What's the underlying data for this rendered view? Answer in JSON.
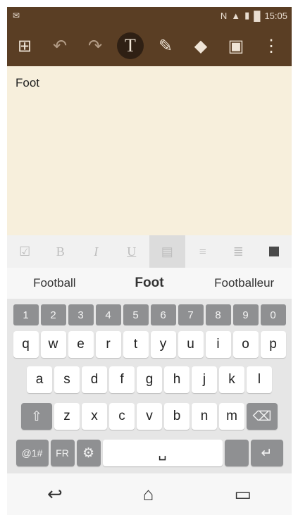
{
  "status": {
    "time": "15:05"
  },
  "toolbar": {
    "items": [
      {
        "name": "grid-icon",
        "glyph": "⊞"
      },
      {
        "name": "undo-icon",
        "glyph": "↶"
      },
      {
        "name": "redo-icon",
        "glyph": "↷"
      },
      {
        "name": "text-tool-icon",
        "glyph": "T"
      },
      {
        "name": "pen-icon",
        "glyph": "✎"
      },
      {
        "name": "eraser-icon",
        "glyph": "⌫"
      },
      {
        "name": "save-icon",
        "glyph": "💾"
      },
      {
        "name": "more-icon",
        "glyph": "⋮"
      }
    ]
  },
  "note": {
    "text": "Foot"
  },
  "format": {
    "items": [
      "☑",
      "B",
      "I",
      "U",
      "▤",
      "≡",
      "≣",
      "■"
    ]
  },
  "suggestions": {
    "left": "Football",
    "center": "Foot",
    "right": "Footballeur"
  },
  "keyboard": {
    "numbers": [
      "1",
      "2",
      "3",
      "4",
      "5",
      "6",
      "7",
      "8",
      "9",
      "0"
    ],
    "row1": [
      "q",
      "w",
      "e",
      "r",
      "t",
      "y",
      "u",
      "i",
      "o",
      "p"
    ],
    "row2": [
      "a",
      "s",
      "d",
      "f",
      "g",
      "h",
      "j",
      "k",
      "l"
    ],
    "row3": [
      "z",
      "x",
      "c",
      "v",
      "b",
      "n",
      "m"
    ],
    "shift": "⇧",
    "backspace": "⌫",
    "sym": "@1#",
    "lang": "FR",
    "settings": "⚙",
    "space": "␣",
    "enter": "↵"
  },
  "nav": {
    "back": "↩",
    "home": "⌂",
    "recent": "▭"
  }
}
